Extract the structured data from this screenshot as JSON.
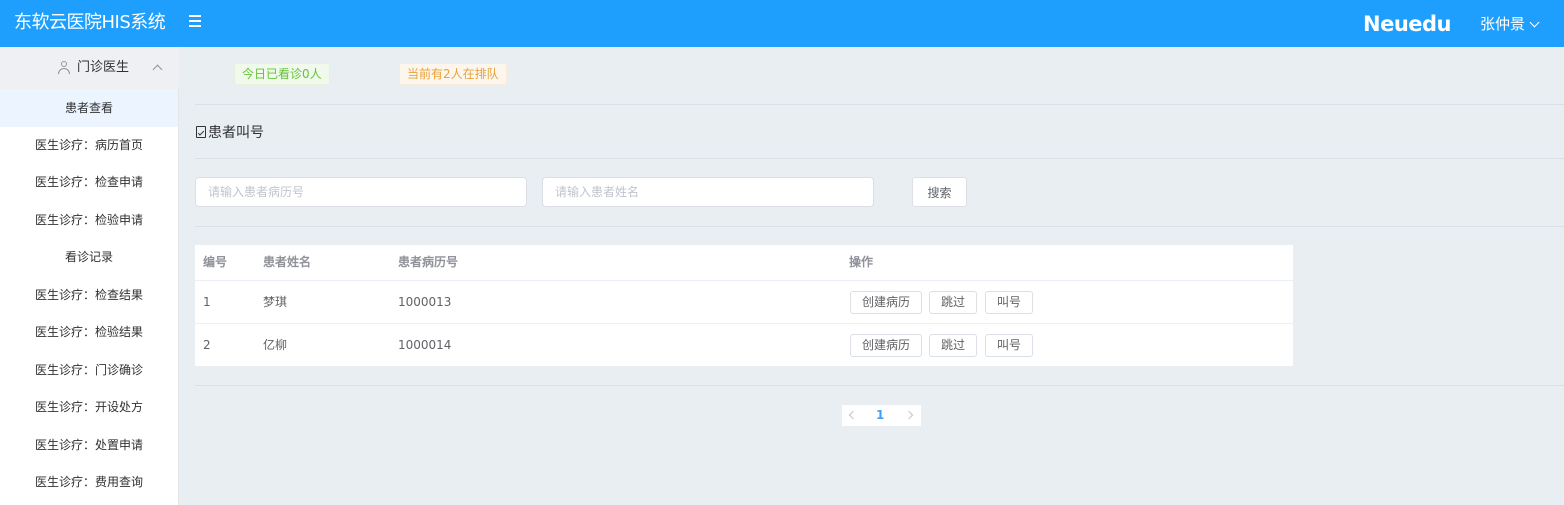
{
  "header": {
    "title": "东软云医院HIS系统",
    "brand": "Neuedu",
    "user": "张仲景"
  },
  "sidebar": {
    "group_label": "门诊医生",
    "items": [
      {
        "label": "患者查看",
        "active": true
      },
      {
        "label": "医生诊疗：病历首页"
      },
      {
        "label": "医生诊疗：检查申请"
      },
      {
        "label": "医生诊疗：检验申请"
      },
      {
        "label": "看诊记录"
      },
      {
        "label": "医生诊疗：检查结果"
      },
      {
        "label": "医生诊疗：检验结果"
      },
      {
        "label": "医生诊疗：门诊确诊"
      },
      {
        "label": "医生诊疗：开设处方"
      },
      {
        "label": "医生诊疗：处置申请"
      },
      {
        "label": "医生诊疗：费用查询"
      }
    ]
  },
  "status": {
    "seen_today": "今日已看诊0人",
    "queue": "当前有2人在排队"
  },
  "section": {
    "title": "患者叫号"
  },
  "search": {
    "record_placeholder": "请输入患者病历号",
    "name_placeholder": "请输入患者姓名",
    "button": "搜索"
  },
  "table": {
    "columns": [
      "编号",
      "患者姓名",
      "患者病历号",
      "操作"
    ],
    "rows": [
      {
        "no": "1",
        "name": "梦琪",
        "record": "1000013"
      },
      {
        "no": "2",
        "name": "亿柳",
        "record": "1000014"
      }
    ],
    "actions": {
      "create": "创建病历",
      "skip": "跳过",
      "call": "叫号"
    }
  },
  "pagination": {
    "current": "1"
  }
}
